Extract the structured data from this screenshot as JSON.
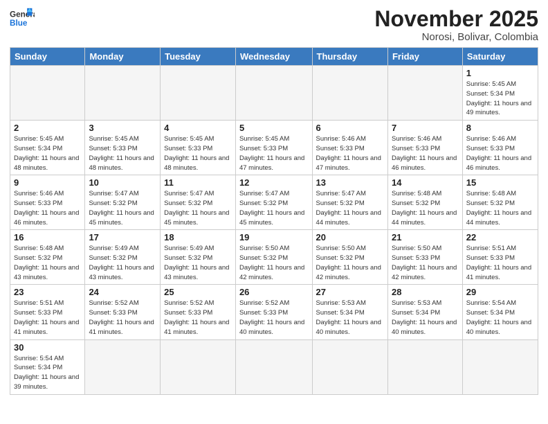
{
  "header": {
    "logo_general": "General",
    "logo_blue": "Blue",
    "month_title": "November 2025",
    "location": "Norosi, Bolivar, Colombia"
  },
  "weekdays": [
    "Sunday",
    "Monday",
    "Tuesday",
    "Wednesday",
    "Thursday",
    "Friday",
    "Saturday"
  ],
  "weeks": [
    [
      {
        "day": "",
        "info": ""
      },
      {
        "day": "",
        "info": ""
      },
      {
        "day": "",
        "info": ""
      },
      {
        "day": "",
        "info": ""
      },
      {
        "day": "",
        "info": ""
      },
      {
        "day": "",
        "info": ""
      },
      {
        "day": "1",
        "info": "Sunrise: 5:45 AM\nSunset: 5:34 PM\nDaylight: 11 hours\nand 49 minutes."
      }
    ],
    [
      {
        "day": "2",
        "info": "Sunrise: 5:45 AM\nSunset: 5:34 PM\nDaylight: 11 hours\nand 48 minutes."
      },
      {
        "day": "3",
        "info": "Sunrise: 5:45 AM\nSunset: 5:33 PM\nDaylight: 11 hours\nand 48 minutes."
      },
      {
        "day": "4",
        "info": "Sunrise: 5:45 AM\nSunset: 5:33 PM\nDaylight: 11 hours\nand 48 minutes."
      },
      {
        "day": "5",
        "info": "Sunrise: 5:45 AM\nSunset: 5:33 PM\nDaylight: 11 hours\nand 47 minutes."
      },
      {
        "day": "6",
        "info": "Sunrise: 5:46 AM\nSunset: 5:33 PM\nDaylight: 11 hours\nand 47 minutes."
      },
      {
        "day": "7",
        "info": "Sunrise: 5:46 AM\nSunset: 5:33 PM\nDaylight: 11 hours\nand 46 minutes."
      },
      {
        "day": "8",
        "info": "Sunrise: 5:46 AM\nSunset: 5:33 PM\nDaylight: 11 hours\nand 46 minutes."
      }
    ],
    [
      {
        "day": "9",
        "info": "Sunrise: 5:46 AM\nSunset: 5:33 PM\nDaylight: 11 hours\nand 46 minutes."
      },
      {
        "day": "10",
        "info": "Sunrise: 5:47 AM\nSunset: 5:32 PM\nDaylight: 11 hours\nand 45 minutes."
      },
      {
        "day": "11",
        "info": "Sunrise: 5:47 AM\nSunset: 5:32 PM\nDaylight: 11 hours\nand 45 minutes."
      },
      {
        "day": "12",
        "info": "Sunrise: 5:47 AM\nSunset: 5:32 PM\nDaylight: 11 hours\nand 45 minutes."
      },
      {
        "day": "13",
        "info": "Sunrise: 5:47 AM\nSunset: 5:32 PM\nDaylight: 11 hours\nand 44 minutes."
      },
      {
        "day": "14",
        "info": "Sunrise: 5:48 AM\nSunset: 5:32 PM\nDaylight: 11 hours\nand 44 minutes."
      },
      {
        "day": "15",
        "info": "Sunrise: 5:48 AM\nSunset: 5:32 PM\nDaylight: 11 hours\nand 44 minutes."
      }
    ],
    [
      {
        "day": "16",
        "info": "Sunrise: 5:48 AM\nSunset: 5:32 PM\nDaylight: 11 hours\nand 43 minutes."
      },
      {
        "day": "17",
        "info": "Sunrise: 5:49 AM\nSunset: 5:32 PM\nDaylight: 11 hours\nand 43 minutes."
      },
      {
        "day": "18",
        "info": "Sunrise: 5:49 AM\nSunset: 5:32 PM\nDaylight: 11 hours\nand 43 minutes."
      },
      {
        "day": "19",
        "info": "Sunrise: 5:50 AM\nSunset: 5:32 PM\nDaylight: 11 hours\nand 42 minutes."
      },
      {
        "day": "20",
        "info": "Sunrise: 5:50 AM\nSunset: 5:32 PM\nDaylight: 11 hours\nand 42 minutes."
      },
      {
        "day": "21",
        "info": "Sunrise: 5:50 AM\nSunset: 5:33 PM\nDaylight: 11 hours\nand 42 minutes."
      },
      {
        "day": "22",
        "info": "Sunrise: 5:51 AM\nSunset: 5:33 PM\nDaylight: 11 hours\nand 41 minutes."
      }
    ],
    [
      {
        "day": "23",
        "info": "Sunrise: 5:51 AM\nSunset: 5:33 PM\nDaylight: 11 hours\nand 41 minutes."
      },
      {
        "day": "24",
        "info": "Sunrise: 5:52 AM\nSunset: 5:33 PM\nDaylight: 11 hours\nand 41 minutes."
      },
      {
        "day": "25",
        "info": "Sunrise: 5:52 AM\nSunset: 5:33 PM\nDaylight: 11 hours\nand 41 minutes."
      },
      {
        "day": "26",
        "info": "Sunrise: 5:52 AM\nSunset: 5:33 PM\nDaylight: 11 hours\nand 40 minutes."
      },
      {
        "day": "27",
        "info": "Sunrise: 5:53 AM\nSunset: 5:34 PM\nDaylight: 11 hours\nand 40 minutes."
      },
      {
        "day": "28",
        "info": "Sunrise: 5:53 AM\nSunset: 5:34 PM\nDaylight: 11 hours\nand 40 minutes."
      },
      {
        "day": "29",
        "info": "Sunrise: 5:54 AM\nSunset: 5:34 PM\nDaylight: 11 hours\nand 40 minutes."
      }
    ],
    [
      {
        "day": "30",
        "info": "Sunrise: 5:54 AM\nSunset: 5:34 PM\nDaylight: 11 hours\nand 39 minutes."
      },
      {
        "day": "",
        "info": ""
      },
      {
        "day": "",
        "info": ""
      },
      {
        "day": "",
        "info": ""
      },
      {
        "day": "",
        "info": ""
      },
      {
        "day": "",
        "info": ""
      },
      {
        "day": "",
        "info": ""
      }
    ]
  ]
}
